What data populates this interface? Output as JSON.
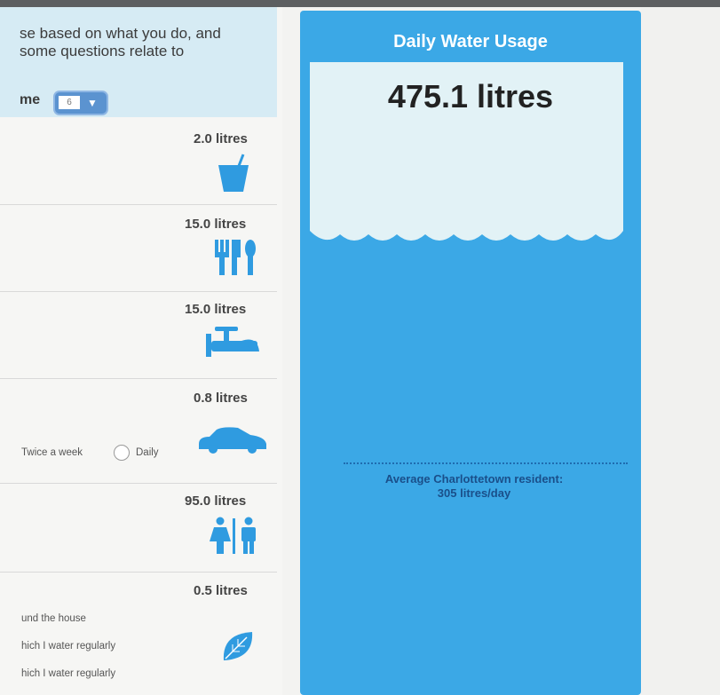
{
  "intro": {
    "line1": "se based on what you do, and",
    "line2": "some questions relate to"
  },
  "household": {
    "label_fragment": "me",
    "select_value": "6"
  },
  "items": [
    {
      "amount": "2.0 litres",
      "icon": "drinking-glass-icon"
    },
    {
      "amount": "15.0 litres",
      "icon": "utensils-icon"
    },
    {
      "amount": "15.0 litres",
      "icon": "faucet-icon"
    },
    {
      "amount": "0.8 litres",
      "icon": "car-icon",
      "options": [
        "Twice a week",
        "Daily"
      ]
    },
    {
      "amount": "95.0 litres",
      "icon": "restroom-icon"
    },
    {
      "amount": "0.5 litres",
      "icon": "leaf-icon",
      "lines": [
        "und the house",
        "hich I water regularly",
        "hich I water regularly"
      ]
    }
  ],
  "usage": {
    "title": "Daily Water Usage",
    "total": "475.1 litres",
    "average_label": "Average Charlottetown resident:",
    "average_value": "305 litres/day"
  },
  "colors": {
    "panel_blue": "#3ba8e6",
    "water_light": "#e2f2f6",
    "icon_blue": "#2f9be0"
  }
}
